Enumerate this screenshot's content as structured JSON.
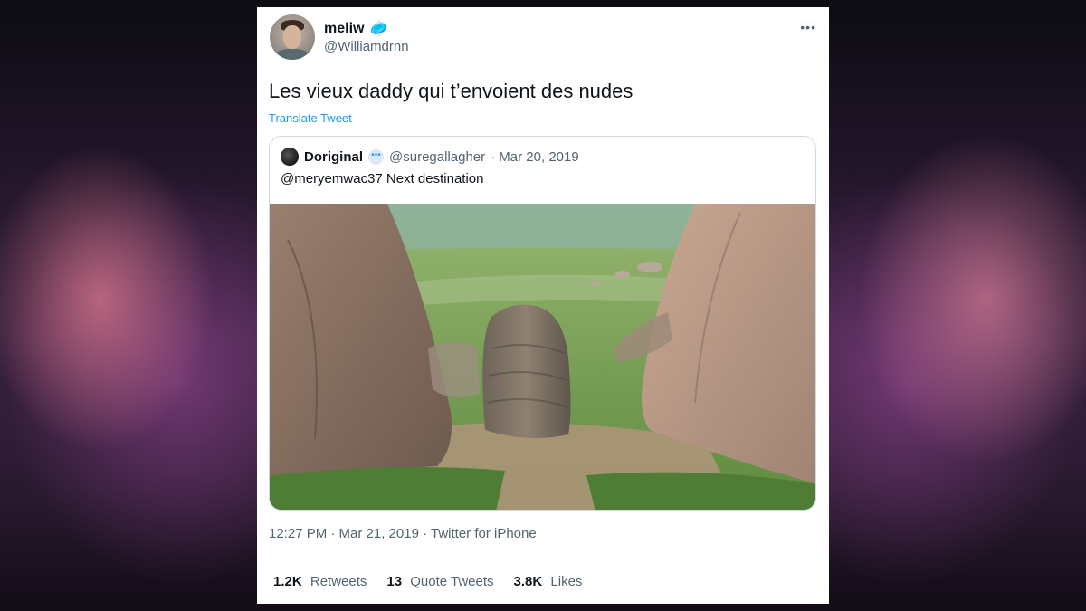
{
  "tweet": {
    "author_name": "meliw",
    "author_emoji": "🥏",
    "author_handle": "@Williamdrnn",
    "more_icon": "•••",
    "text": "Les vieux daddy qui t’envoient des nudes",
    "translate_label": "Translate Tweet",
    "timestamp": "12:27 PM · Mar 21, 2019 · Twitter for iPhone"
  },
  "quoted": {
    "name": "Doriginal",
    "badge_icon": "💬",
    "handle": "@suregallagher",
    "date": "· Mar 20, 2019",
    "text": "@meryemwac37 Next destination"
  },
  "stats": [
    {
      "value": "1.2K",
      "label": "Retweets"
    },
    {
      "value": "13",
      "label": "Quote Tweets"
    },
    {
      "value": "3.8K",
      "label": "Likes"
    }
  ],
  "colors": {
    "link": "#1d9bf0",
    "text": "#0f1419",
    "muted": "#536471"
  }
}
